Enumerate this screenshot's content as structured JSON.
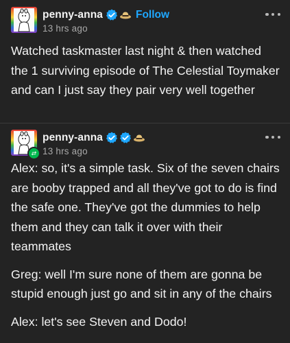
{
  "posts": [
    {
      "username": "penny-anna",
      "time": "13 hrs ago",
      "follow_label": "Follow",
      "show_follow": true,
      "reblog": false,
      "paragraphs": [
        "Watched taskmaster last night & then watched the 1 surviving episode of The Celestial Toymaker and can I just say they pair very well together"
      ]
    },
    {
      "username": "penny-anna",
      "time": "13 hrs ago",
      "show_follow": false,
      "reblog": true,
      "paragraphs": [
        "Alex: so, it's a simple task. Six of the seven chairs are booby trapped and all they've got to do is find the safe one. They've got the dummies to help them and they can talk it over with their teammates",
        "Greg: well I'm sure none of them are gonna be stupid enough just go and sit in any of the chairs",
        "Alex: let's see Steven and Dodo!"
      ]
    }
  ],
  "colors": {
    "background": "#232323",
    "accent": "#1ea7ff",
    "verified": "#1ea7ff",
    "reblog_badge": "#00b84d"
  },
  "icons": [
    "verified-badge-icon",
    "hat-badge-icon",
    "more-options-icon",
    "reblog-icon"
  ]
}
